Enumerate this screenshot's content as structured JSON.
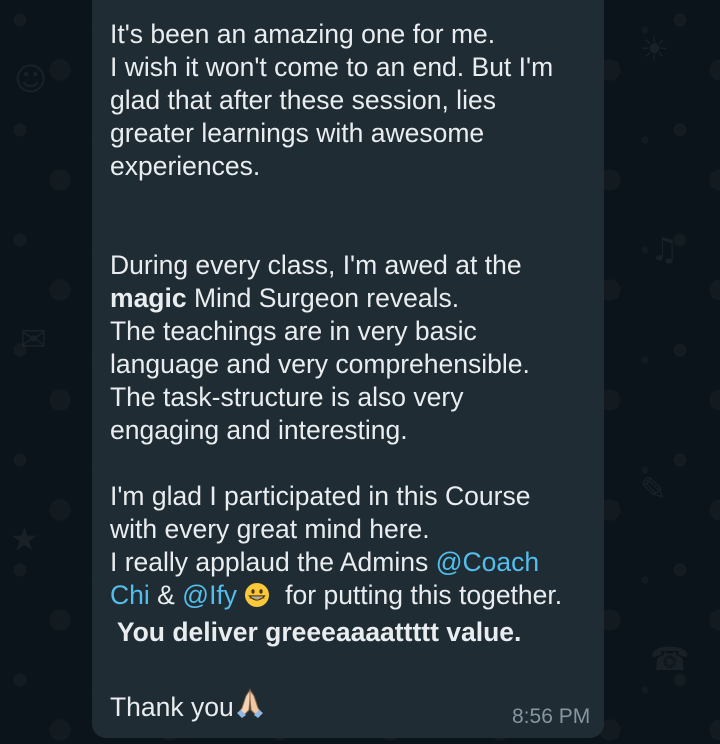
{
  "message": {
    "p1": [
      "It's been an amazing one for me.",
      "I wish it won't come to an end. But I'm",
      "glad that after these session, lies",
      "greater learnings with awesome",
      "experiences."
    ],
    "p2": {
      "l1": "During every class, I'm awed at the",
      "l2_bold": "magic",
      "l2_rest": " Mind Surgeon reveals.",
      "l3": "The teachings are in very basic",
      "l4": "language and very comprehensible.",
      "l5": "The task-structure is also very",
      "l6": "engaging and interesting."
    },
    "p3": {
      "l1": "I'm glad I participated in this Course",
      "l2": "with every great mind here.",
      "l3_prefix": "I really applaud the Admins ",
      "mention_coach_part1": "@Coach",
      "mention_coach_part2": "Chi",
      "amp": " & ",
      "mention_ify": "@Ify",
      "l4_suffix": "  for putting this together.",
      "bold_line": " You deliver greeeaaaattttt value."
    },
    "closing": "Thank you",
    "time": "8:56 PM"
  },
  "icons": {
    "grin": "grinning-face-emoji",
    "pray": "folded-hands-emoji"
  },
  "colors": {
    "background": "#0b141a",
    "bubble": "#1f2c33",
    "text": "#e9edef",
    "mention": "#53bdeb",
    "timestamp": "#8696a0",
    "accent": "#25d366"
  }
}
